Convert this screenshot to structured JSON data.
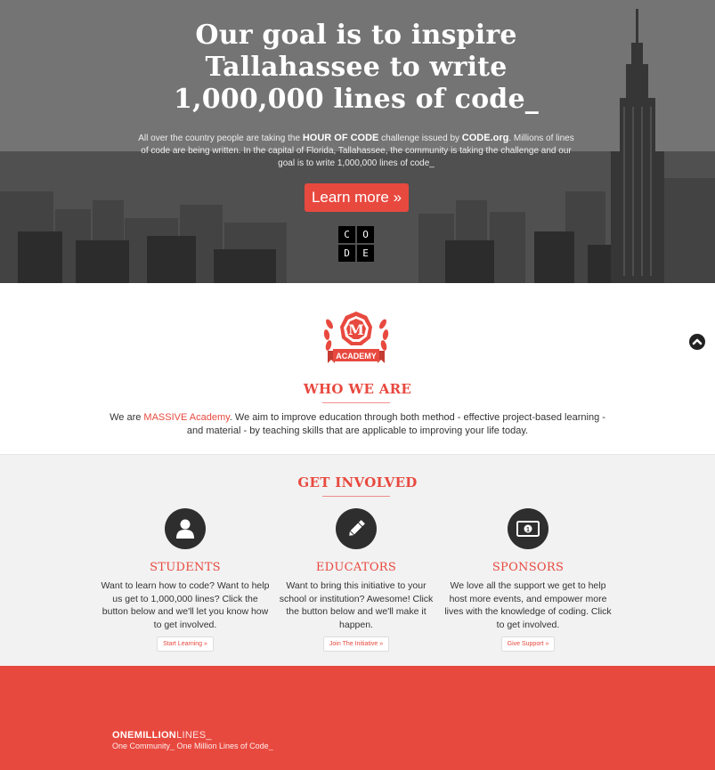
{
  "hero": {
    "title": "Our goal is to inspire Tallahassee to write 1,000,000 lines of code_",
    "text_part1": "All over the country people are taking the ",
    "text_bold1": "HOUR OF CODE",
    "text_part2": " challenge issued by ",
    "text_bold2": "CODE.org",
    "text_part3": ". Millions of lines of code are being written. In the capital of Florida, Tallahassee, the community is taking the challenge and our goal is to write 1,000,000 lines of code_",
    "button_label": "Learn more »",
    "code_logo_letters": [
      "C",
      "O",
      "D",
      "E"
    ]
  },
  "who": {
    "logo_letter": "M",
    "logo_banner": "ACADEMY",
    "title": "WHO WE ARE",
    "text_before": "We are ",
    "text_accent": "MASSIVE Academy",
    "text_after": ". We aim to improve education through both method - effective project-based learning - and material - by teaching skills that are applicable to improving your life today."
  },
  "involved": {
    "title": "GET INVOLVED",
    "columns": [
      {
        "icon": "user-icon",
        "heading": "STUDENTS",
        "text": "Want to learn how to code? Want to help us get to 1,000,000 lines? Click the button below and we'll let you know how to get involved.",
        "button": "Start Learning »"
      },
      {
        "icon": "pencil-icon",
        "heading": "EDUCATORS",
        "text": "Want to bring this initiative to your school or institution? Awesome! Click the button below and we'll make it happen.",
        "button": "Join The Initiative »"
      },
      {
        "icon": "money-icon",
        "heading": "SPONSORS",
        "text": "We love all the support we get to help host more events, and empower more lives with the knowledge of coding. Click to get involved.",
        "button": "Give Support »"
      }
    ]
  },
  "footer": {
    "brand_bold": "ONEMILLION",
    "brand_light": "LINES_",
    "tagline": "One Community_ One Million Lines of Code_"
  },
  "colors": {
    "accent": "#e8493f",
    "dark": "#2e2e2e",
    "light_bg": "#f2f2f2"
  },
  "icons": [
    "scroll-top-icon",
    "user-icon",
    "pencil-icon",
    "money-icon",
    "academy-logo"
  ]
}
